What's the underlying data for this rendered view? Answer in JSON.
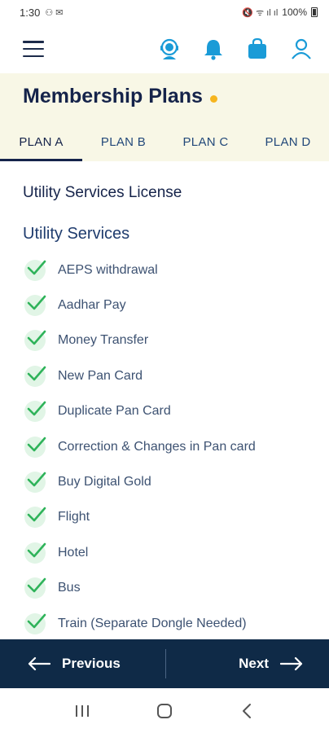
{
  "status_bar": {
    "time": "1:30",
    "left_glyphs": "⚇ ✉",
    "right_glyphs": "🔇 ᯤ ıl ıl",
    "battery": "100%"
  },
  "header": {
    "icons": [
      "menu-icon",
      "support-agent-icon",
      "bell-icon",
      "shopping-bag-icon",
      "user-icon"
    ]
  },
  "page": {
    "title": "Membership Plans",
    "accent_dot_color": "#f6b51e"
  },
  "tabs": [
    {
      "label": "PLAN A",
      "active": true
    },
    {
      "label": "PLAN B",
      "active": false
    },
    {
      "label": "PLAN C",
      "active": false
    },
    {
      "label": "PLAN D",
      "active": false
    }
  ],
  "content": {
    "license_heading": "Utility Services License",
    "section_heading": "Utility Services",
    "services": [
      "AEPS withdrawal",
      "Aadhar Pay",
      "Money Transfer",
      "New Pan Card",
      "Duplicate Pan Card",
      "Correction & Changes in Pan card",
      "Buy Digital Gold",
      "Flight",
      "Hotel",
      "Bus",
      "Train (Separate Dongle Needed)"
    ]
  },
  "footer": {
    "previous_label": "Previous",
    "next_label": "Next"
  },
  "colors": {
    "primary": "#15234a",
    "accent_blue": "#1a9bd7",
    "check_green": "#2fb35a",
    "footer_bg": "#0f2a47"
  }
}
